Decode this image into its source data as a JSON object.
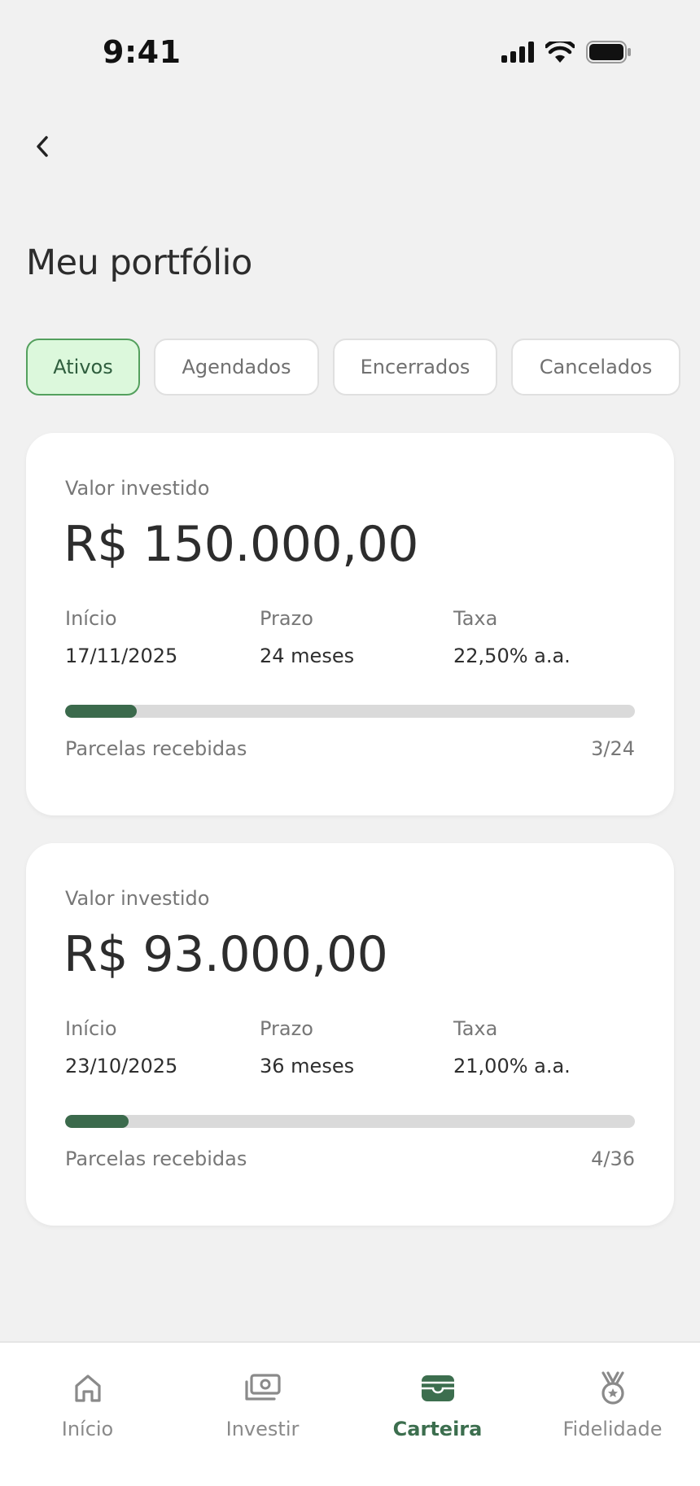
{
  "status_bar": {
    "time": "9:41"
  },
  "page": {
    "title": "Meu portfólio"
  },
  "tabs": [
    {
      "label": "Ativos",
      "active": true
    },
    {
      "label": "Agendados",
      "active": false
    },
    {
      "label": "Encerrados",
      "active": false
    },
    {
      "label": "Cancelados",
      "active": false
    }
  ],
  "investments": [
    {
      "label": "Valor investido",
      "amount": "R$ 150.000,00",
      "start_label": "Início",
      "start": "17/11/2025",
      "term_label": "Prazo",
      "term": "24 meses",
      "rate_label": "Taxa",
      "rate": "22,50% a.a.",
      "installments_label": "Parcelas recebidas",
      "installments": "3/24",
      "progress_fraction": 0.125
    },
    {
      "label": "Valor investido",
      "amount": "R$ 93.000,00",
      "start_label": "Início",
      "start": "23/10/2025",
      "term_label": "Prazo",
      "term": "36 meses",
      "rate_label": "Taxa",
      "rate": "21,00% a.a.",
      "installments_label": "Parcelas recebidas",
      "installments": "4/36",
      "progress_fraction": 0.111
    }
  ],
  "bottom_nav": [
    {
      "label": "Início",
      "icon": "home-icon",
      "active": false
    },
    {
      "label": "Investir",
      "icon": "money-icon",
      "active": false
    },
    {
      "label": "Carteira",
      "icon": "wallet-icon",
      "active": true
    },
    {
      "label": "Fidelidade",
      "icon": "medal-icon",
      "active": false
    }
  ],
  "colors": {
    "accent": "#3b6a4c",
    "active_tab_bg": "#dcf8dc",
    "active_tab_border": "#54a05e",
    "progress_track": "#dadada",
    "background": "#f1f1f1"
  }
}
